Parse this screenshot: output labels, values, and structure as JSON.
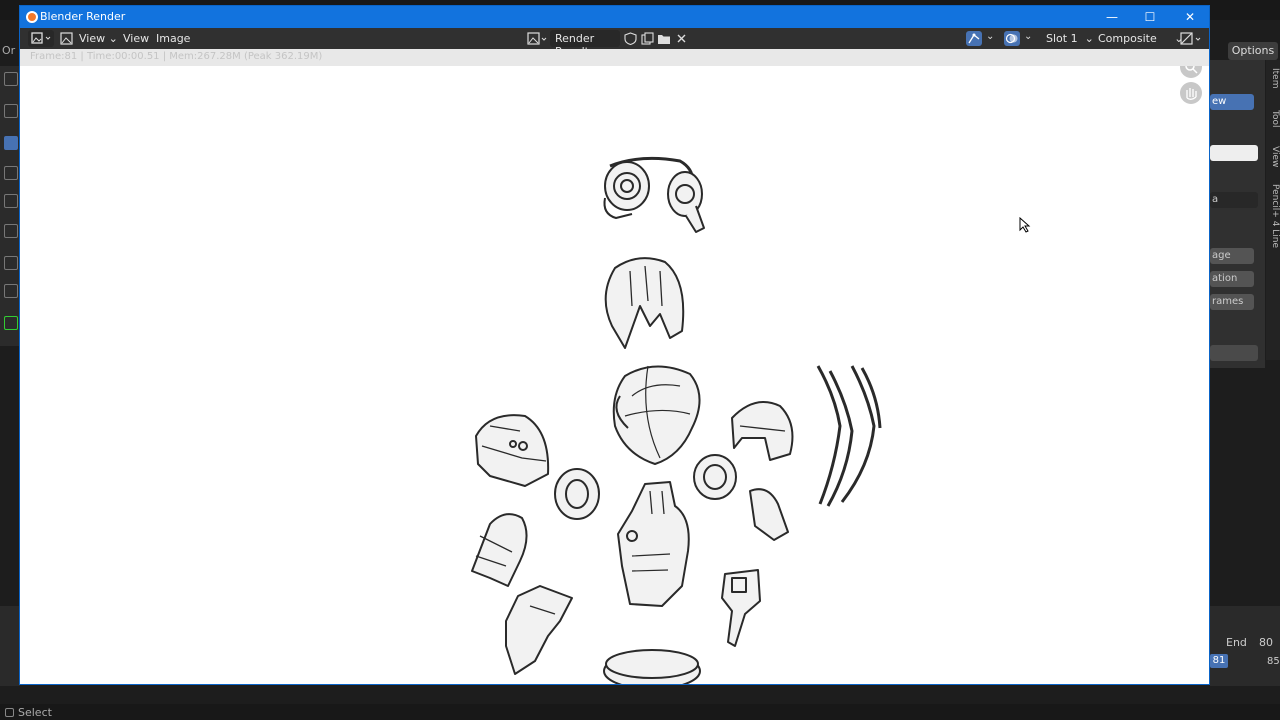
{
  "window": {
    "title": "Blender Render",
    "controls": {
      "minimize": "—",
      "maximize": "☐",
      "close": "✕"
    }
  },
  "header": {
    "menus": [
      "View",
      "View",
      "Image"
    ],
    "image_name": "Render Result",
    "slot": "Slot 1",
    "layer": "Composite"
  },
  "metadata": {
    "text": "Frame:81 | Time:00:00.51 | Mem:267.28M (Peak 362.19M)"
  },
  "background_ui": {
    "options_label": "Options",
    "panel_buttons": [
      "ew",
      "age",
      "ation",
      "rames"
    ],
    "panel_dropdown": "a",
    "side_tabs": [
      "Item",
      "Tool",
      "View",
      "Pencil+ 4 Line"
    ],
    "left_label": "Or",
    "timeline": {
      "end_label": "End",
      "end_value": "80",
      "current_frame": "81",
      "next_frame": "85"
    },
    "status": "Select"
  },
  "colors": {
    "titlebar": "#1273de",
    "header": "#303030",
    "accent": "#4772b3",
    "canvas": "#ffffff"
  },
  "icons": {
    "editor_type": "image-editor-icon",
    "image_browse": "image-browse-icon",
    "fake_user": "shield-icon",
    "new_image": "duplicate-icon",
    "open_image": "folder-icon",
    "unlink": "close-icon",
    "gizmo": "gizmo-icon",
    "overlay": "overlay-icon",
    "display_channels": "display-channels-icon"
  }
}
